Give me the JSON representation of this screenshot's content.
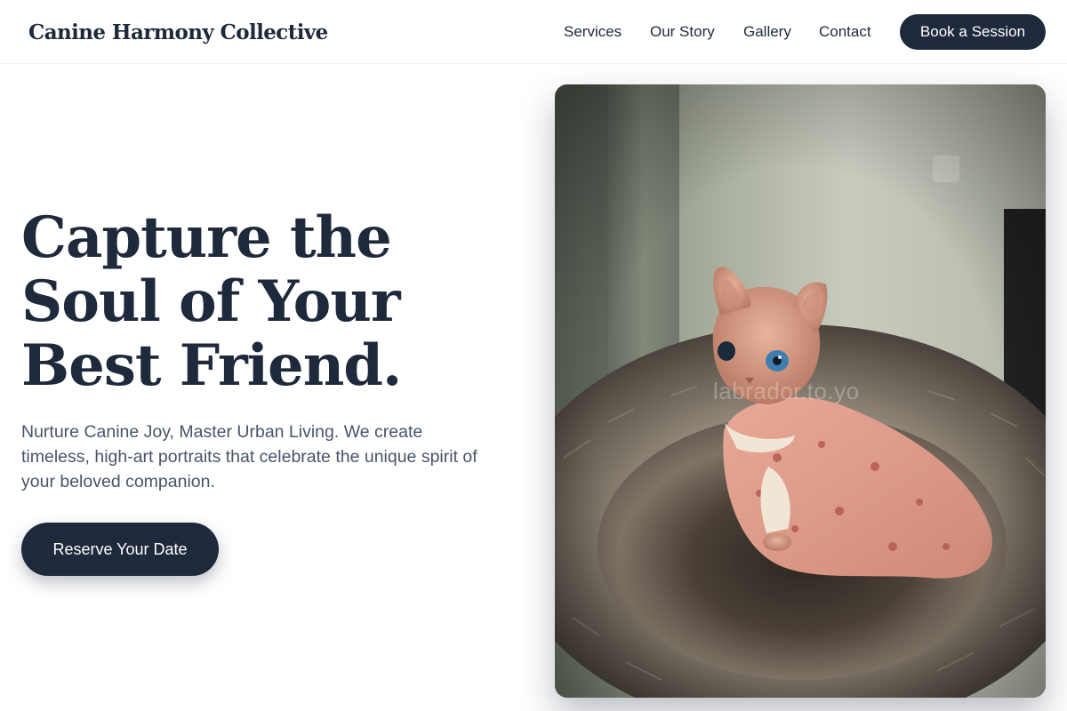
{
  "header": {
    "logo": "Canine Harmony Collective",
    "nav": [
      "Services",
      "Our Story",
      "Gallery",
      "Contact"
    ],
    "cta": "Book a Session"
  },
  "hero": {
    "title_lines": [
      "Capture the",
      "Soul of Your",
      "Best Friend."
    ],
    "subtitle": "Nurture Canine Joy, Master Urban Living. We create timeless, high-art portraits that celebrate the unique spirit of your beloved companion.",
    "cta": "Reserve Your Date"
  },
  "photo": {
    "subject": "hairless sphynx cat in pink patterned sweater sitting in fluffy round pet bed",
    "watermark": "labrador.to.yo"
  },
  "colors": {
    "primary": "#1e293b",
    "text_muted": "#475569",
    "background": "#ffffff"
  }
}
